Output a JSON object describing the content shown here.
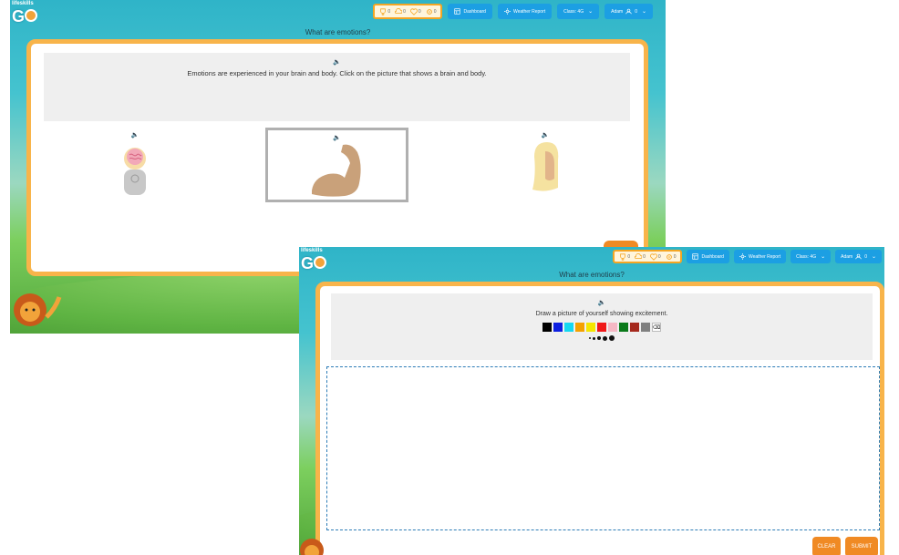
{
  "common": {
    "logo_text": "lifeskills",
    "logo_letter": "G",
    "stats": [
      "0",
      "0",
      "0",
      "0"
    ],
    "dashboard_label": "Dashboard",
    "weather_label": "Weather Report",
    "class_label": "Class: 4G",
    "user_label": "Adam",
    "user_count": "0",
    "icons": [
      "trophy-icon",
      "cloud-icon",
      "heart-icon",
      "gear-icon",
      "dashboard-icon",
      "sun-icon",
      "caret-down-icon",
      "speaker-icon"
    ]
  },
  "screen1": {
    "title": "What are emotions?",
    "prompt": "Emotions are experienced in your brain and body. Click on the picture that shows a brain and body.",
    "choices": [
      {
        "name": "brain-body-person",
        "selected": false
      },
      {
        "name": "flexed-arm",
        "selected": true
      },
      {
        "name": "hair-head",
        "selected": false
      }
    ]
  },
  "screen2": {
    "title": "What are emotions?",
    "prompt": "Draw a picture of yourself showing excitement.",
    "colors": [
      "#000000",
      "#0d1fe0",
      "#16d8f0",
      "#f5a100",
      "#f5e600",
      "#f01818",
      "#f5b8c4",
      "#0a7a1a",
      "#a52a1e",
      "#808080"
    ],
    "brush_sizes": [
      2,
      3,
      4,
      5,
      6
    ],
    "clear_label": "CLEAR",
    "submit_label": "SUBMIT"
  }
}
